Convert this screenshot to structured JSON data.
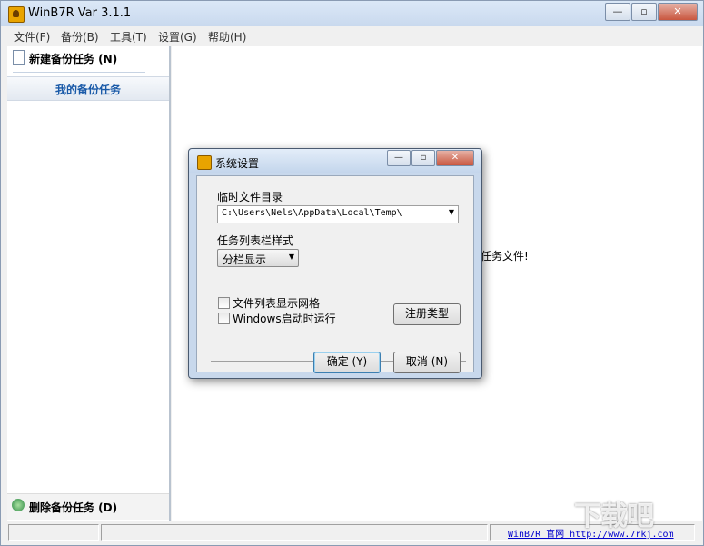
{
  "window": {
    "title": "WinB7R Var 3.1.1",
    "buttons": {
      "minimize": "—",
      "maximize": "▫",
      "close": "✕"
    }
  },
  "menu": [
    "文件(F)",
    "备份(B)",
    "工具(T)",
    "设置(G)",
    "帮助(H)"
  ],
  "sidebar": {
    "new_task": "新建备份任务 (N)",
    "my_tasks": "我的备份任务",
    "delete_task": "删除备份任务 (D)"
  },
  "main": {
    "hint_fragment": "任务文件!"
  },
  "statusbar": {
    "link_text": "WinB7R 官网 http://www.7rkj.com"
  },
  "watermark": "下载吧",
  "dialog": {
    "title": "系统设置",
    "buttons": {
      "minimize": "—",
      "maximize": "▫",
      "close": "✕"
    },
    "temp_dir_label": "临时文件目录",
    "temp_dir_value": "C:\\Users\\Nels\\AppData\\Local\\Temp\\",
    "list_style_label": "任务列表栏样式",
    "list_style_value": "分栏显示",
    "checkbox_grid": "文件列表显示网格",
    "checkbox_grid_checked": false,
    "checkbox_startup": "Windows启动时运行",
    "checkbox_startup_checked": false,
    "register_types": "注册类型",
    "ok": "确定 (Y)",
    "cancel": "取消 (N)"
  }
}
